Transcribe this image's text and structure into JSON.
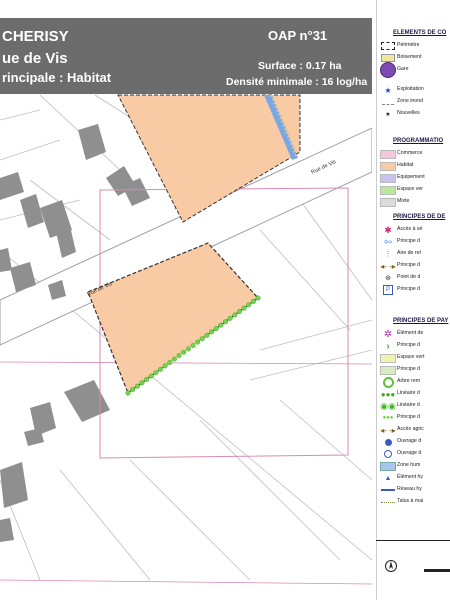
{
  "header": {
    "commune": "CHERISY",
    "street": "ue de Vis",
    "vocation": "rincipale : Habitat",
    "oap_number": "OAP n°31",
    "surface": "Surface : 0.17 ha",
    "density": "Densité minimale : 16 log/ha"
  },
  "map": {
    "road_labels": [
      "Rue de Vis",
      "Rue de Vis"
    ]
  },
  "legend": {
    "sections": [
      {
        "title": "ELEMENTS DE CO",
        "items": [
          {
            "label": "Périmètre",
            "icon": "dashed-rect-icon"
          },
          {
            "label": "Boisement",
            "icon": "hatched-rect-icon"
          },
          {
            "label": "Gare",
            "icon": "train-station-icon"
          },
          {
            "label": "Exploitation",
            "icon": "blue-star-icon"
          },
          {
            "label": "Zone inond",
            "icon": "flood-zone-icon"
          },
          {
            "label": "Nouvelles",
            "icon": "small-star-icon"
          }
        ]
      },
      {
        "title": "PROGRAMMATIO",
        "items": [
          {
            "label": "Commerce",
            "icon": "pink-swatch-icon",
            "color": "#f4c6e0"
          },
          {
            "label": "Habitat",
            "icon": "orange-swatch-icon",
            "color": "#f9cba5"
          },
          {
            "label": "Equipement",
            "icon": "purple-swatch-icon",
            "color": "#c7c3f0"
          },
          {
            "label": "Espace ver",
            "icon": "green-swatch-icon",
            "color": "#b8ea9a"
          },
          {
            "label": "Mixte",
            "icon": "grey-swatch-icon",
            "color": "#dcdcdc"
          }
        ]
      },
      {
        "title": "PRINCIPES DE DE",
        "items": [
          {
            "label": "Accès à sé",
            "icon": "red-star-icon"
          },
          {
            "label": "Principe d",
            "icon": "blue-arrow-icon"
          },
          {
            "label": "Aire de ret",
            "icon": "blue-dots-icon"
          },
          {
            "label": "Principe d",
            "icon": "brown-double-arrow-icon"
          },
          {
            "label": "Point de d",
            "icon": "pin-icon"
          },
          {
            "label": "Principe d",
            "icon": "parking-icon"
          }
        ]
      },
      {
        "title": "PRINCIPES DE PAY",
        "items": [
          {
            "label": "Élément de",
            "icon": "purple-flower-icon"
          },
          {
            "label": "Principe d",
            "icon": "green-chevron-icon"
          },
          {
            "label": "Espace vert",
            "icon": "yellow-swatch-icon"
          },
          {
            "label": "Principe d",
            "icon": "light-green-swatch-icon"
          },
          {
            "label": "Arbre rem",
            "icon": "tree-ring-icon"
          },
          {
            "label": "Linéaire d",
            "icon": "tree-cluster-icon"
          },
          {
            "label": "Linéaire d",
            "icon": "double-ring-icon"
          },
          {
            "label": "Principe d",
            "icon": "green-dots-icon"
          },
          {
            "label": "Accès agric",
            "icon": "brown-double-arrow-icon"
          },
          {
            "label": "Ouvrage d",
            "icon": "blue-circle-icon"
          },
          {
            "label": "Ouvrage d",
            "icon": "blue-ring-icon"
          },
          {
            "label": "Zone hum",
            "icon": "blue-swatch-icon"
          },
          {
            "label": "Élément hy",
            "icon": "blue-triangle-icon"
          },
          {
            "label": "Réseau hy",
            "icon": "blue-line-icon"
          },
          {
            "label": "Talus à mai",
            "icon": "dotted-line-icon"
          }
        ]
      }
    ]
  }
}
